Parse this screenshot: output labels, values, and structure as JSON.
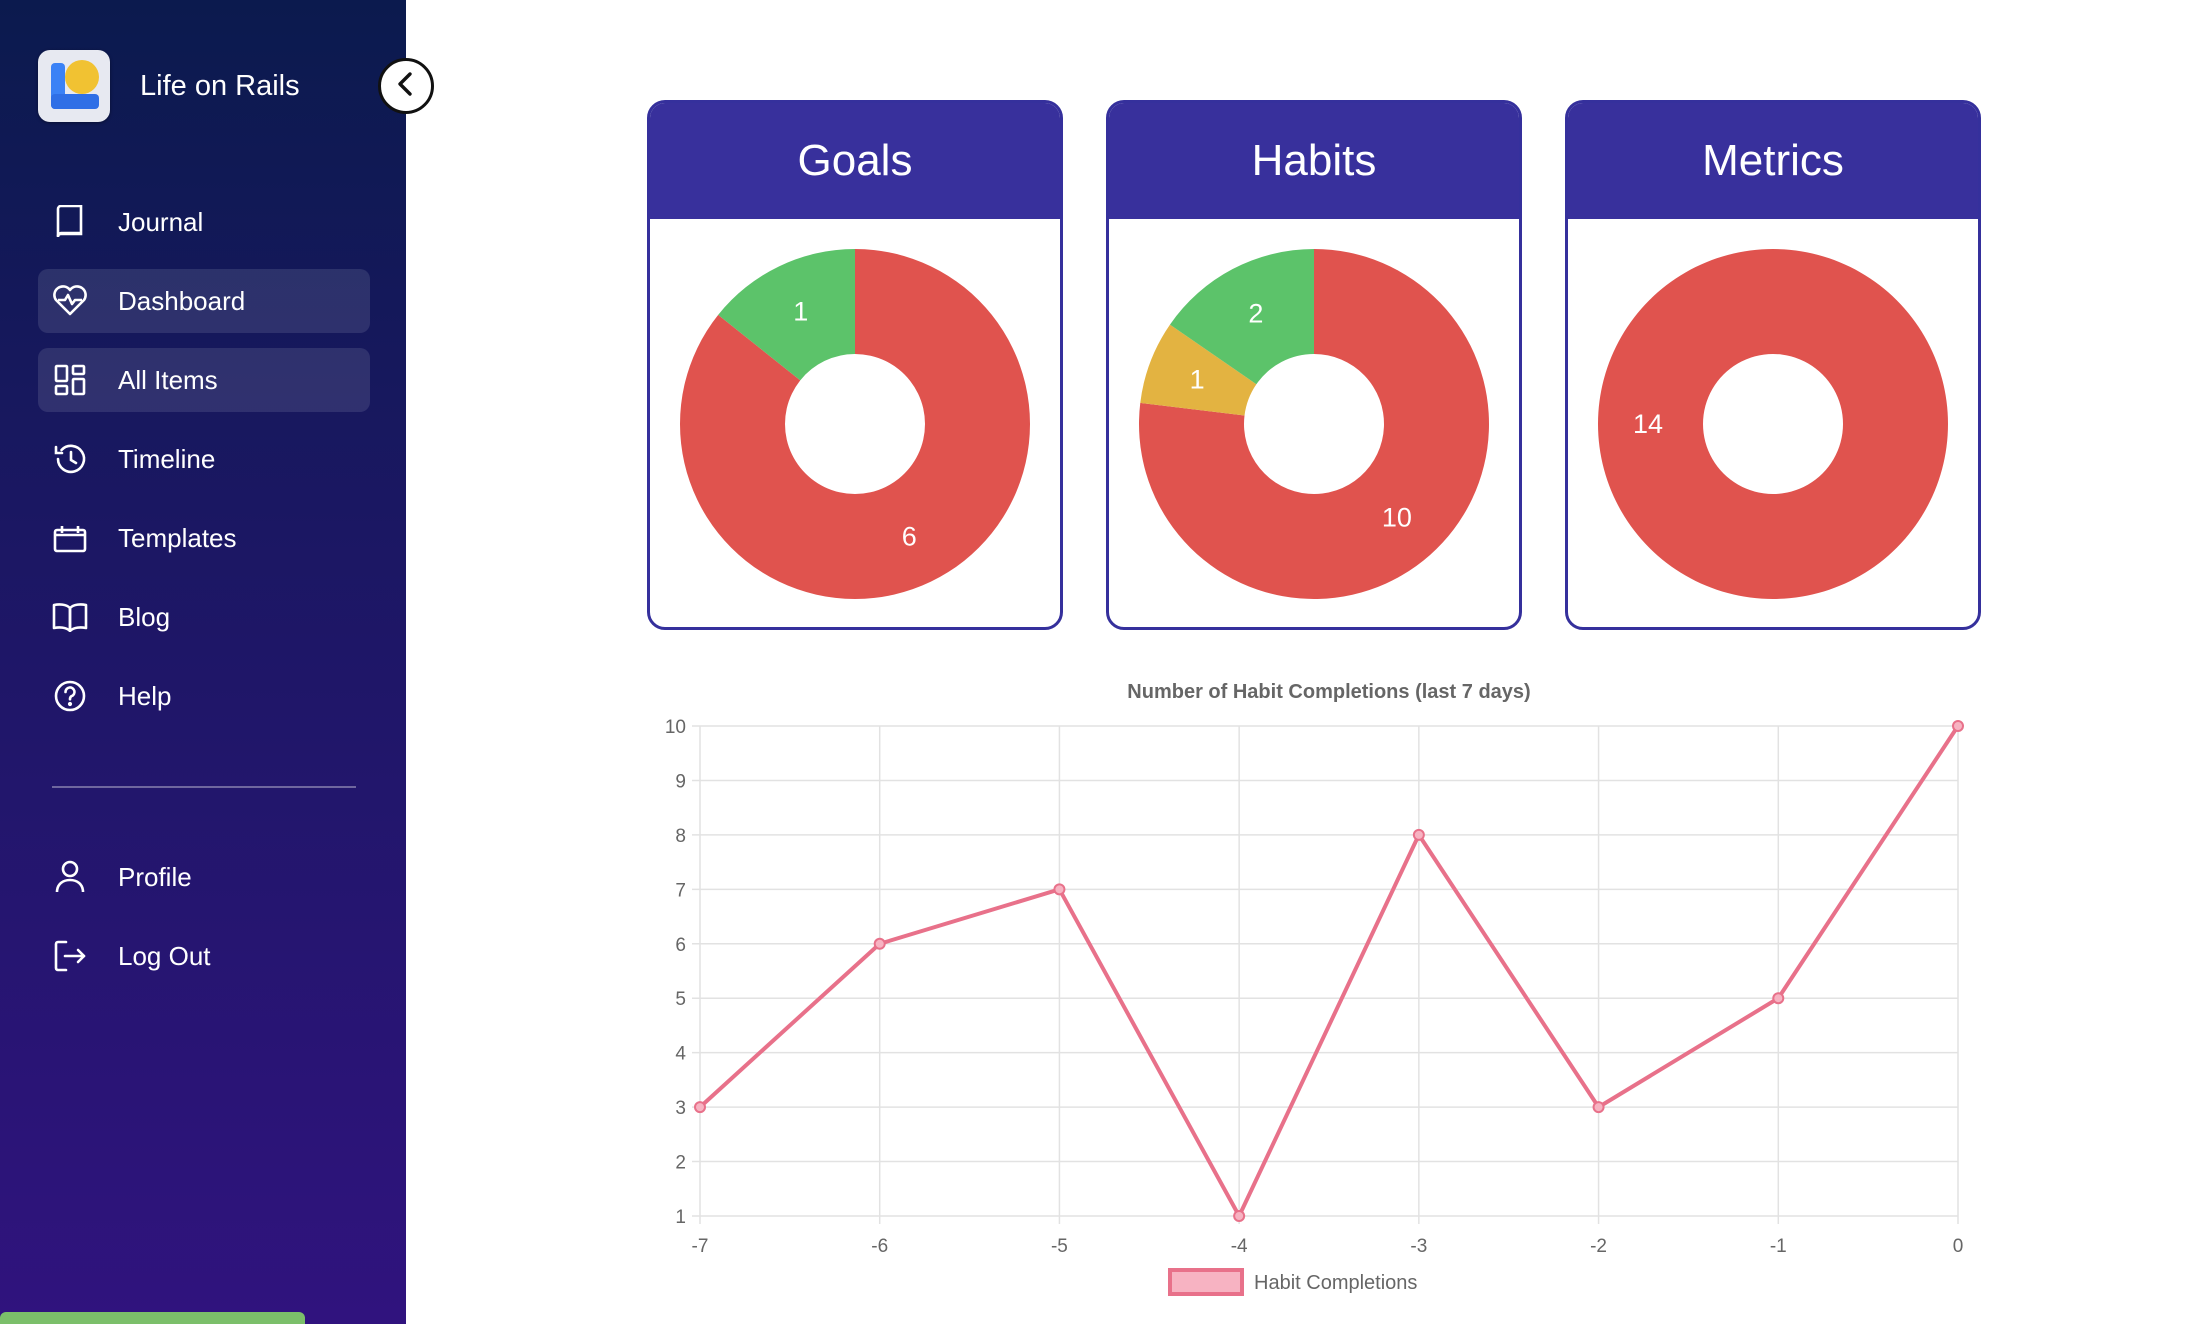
{
  "app": {
    "name": "Life on Rails"
  },
  "sidebar": {
    "items": [
      {
        "label": "Journal",
        "icon": "journal-icon"
      },
      {
        "label": "Dashboard",
        "icon": "heart-pulse-icon",
        "active": true
      },
      {
        "label": "All Items",
        "icon": "grid-icon",
        "active": true
      },
      {
        "label": "Timeline",
        "icon": "history-icon"
      },
      {
        "label": "Templates",
        "icon": "template-icon"
      },
      {
        "label": "Blog",
        "icon": "book-open-icon"
      },
      {
        "label": "Help",
        "icon": "help-icon"
      }
    ],
    "bottom_items": [
      {
        "label": "Profile",
        "icon": "user-icon"
      },
      {
        "label": "Log Out",
        "icon": "logout-icon"
      }
    ]
  },
  "colors": {
    "red": "#e0534e",
    "green": "#5cc36a",
    "yellow": "#e3b341",
    "header": "#38309c",
    "line": "#e8718a"
  },
  "cards": {
    "goals": {
      "title": "Goals",
      "segments": [
        {
          "value": 6,
          "color": "#e0534e",
          "label": "6"
        },
        {
          "value": 1,
          "color": "#5cc36a",
          "label": "1"
        }
      ]
    },
    "habits": {
      "title": "Habits",
      "segments": [
        {
          "value": 10,
          "color": "#e0534e",
          "label": "10"
        },
        {
          "value": 1,
          "color": "#e3b341",
          "label": "1"
        },
        {
          "value": 2,
          "color": "#5cc36a",
          "label": "2"
        }
      ]
    },
    "metrics": {
      "title": "Metrics",
      "segments": [
        {
          "value": 14,
          "color": "#e0534e",
          "label": "14"
        }
      ]
    }
  },
  "chart_data": {
    "type": "line",
    "title": "Number of Habit Completions (last 7 days)",
    "x": [
      -7,
      -6,
      -5,
      -4,
      -3,
      -2,
      -1,
      0
    ],
    "series": [
      {
        "name": "Habit Completions",
        "values": [
          3,
          6,
          7,
          1,
          8,
          3,
          5,
          10
        ],
        "color": "#e8718a"
      }
    ],
    "ylim": [
      1,
      10
    ],
    "y_ticks": [
      1,
      2,
      3,
      4,
      5,
      6,
      7,
      8,
      9,
      10
    ],
    "grid": true,
    "legend": "bottom"
  }
}
